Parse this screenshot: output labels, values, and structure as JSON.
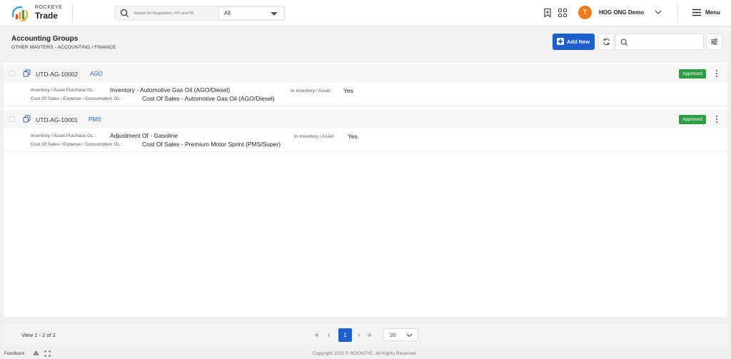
{
  "app": {
    "brand_top": "ROCKEYE",
    "brand_name": "Trade"
  },
  "search": {
    "placeholder": "Search for Requisition, PO and PA",
    "scope": "All"
  },
  "user": {
    "initial": "T",
    "name": "HOG ONG Demo"
  },
  "menu": {
    "label": "Menu"
  },
  "page": {
    "title": "Accounting Groups",
    "breadcrumb": "OTHER MASTERS -  ACCOUNTING / FINANCE",
    "add_new_label": "Add New"
  },
  "labels": {
    "inventory_gl": "Inventory / Asset Purchase GL :",
    "cost_gl": "Cost Of Sales / Expense / Consumption GL :",
    "in_inventory": "In Inventory / Asset :"
  },
  "records": [
    {
      "code": "UTD-AG-10002",
      "tag": "AGO",
      "status": "Approved",
      "inventory_gl": "Inventory - Automotive Gas Oil (AGO/Diesel)",
      "cost_gl": "Cost Of Sales - Automotive Gas Oil (AGO/Diesel)",
      "in_inventory": "Yes"
    },
    {
      "code": "UTD-AG-10001",
      "tag": "PMS",
      "status": "Approved",
      "inventory_gl": "Adjustment Of - Gasoline",
      "cost_gl": "Cost Of Sales - Premium Motor Sprint (PMS/Super)",
      "in_inventory": "Yes"
    }
  ],
  "pagination": {
    "view_info": "View 1 - 2 of 2",
    "current_page": "1",
    "page_size": "20"
  },
  "footer": {
    "feedback": "Feedback",
    "copyright": "Copyright 2025 © ROCKEYE. All Rights Reserved"
  },
  "colors": {
    "primary": "#1e5fd0",
    "approved": "#2e9e45",
    "avatar": "#ee7a1c"
  }
}
